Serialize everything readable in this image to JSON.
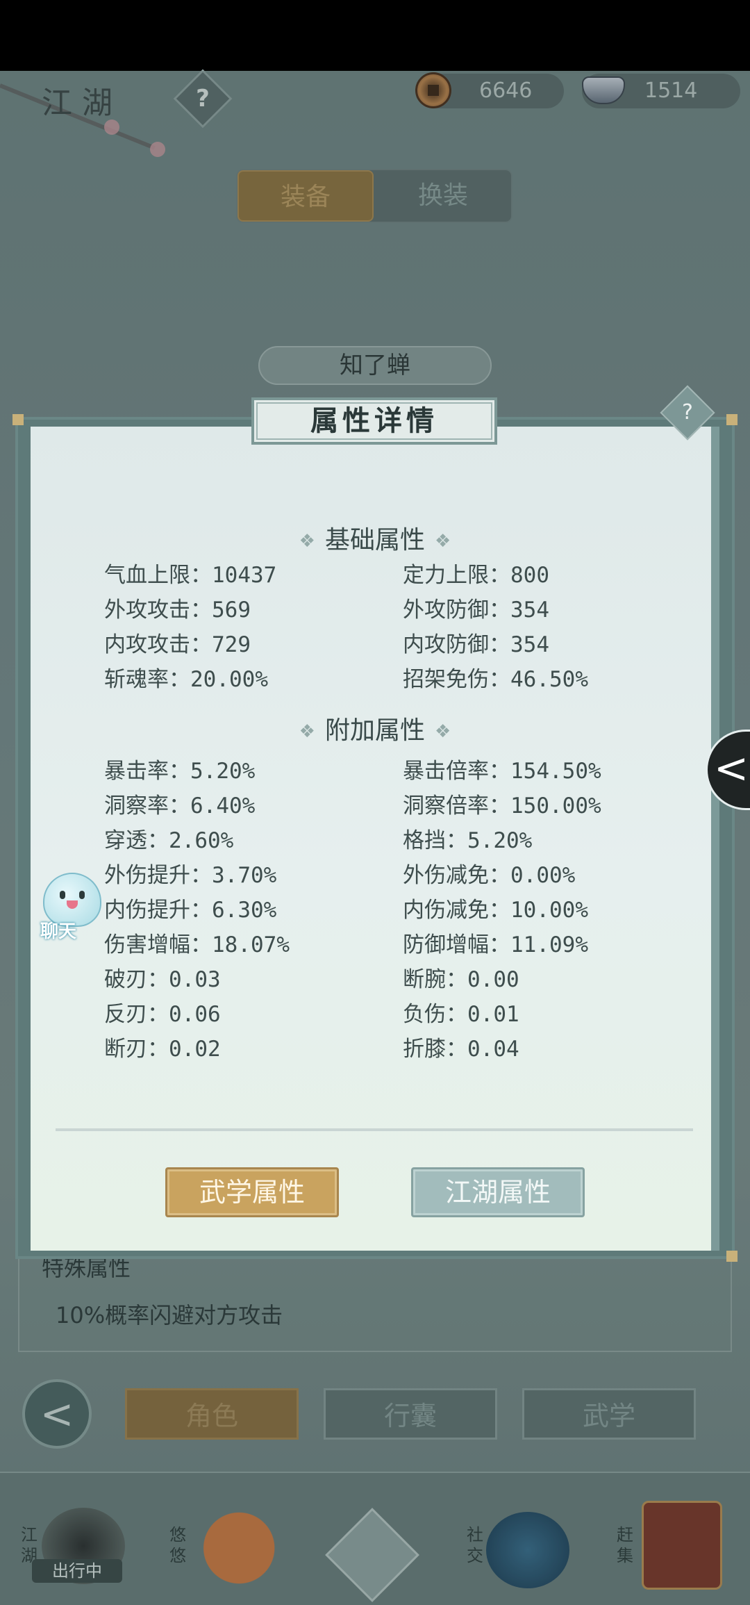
{
  "header": {
    "title": "江湖",
    "help_symbol": "?",
    "copper": "6646",
    "silver": "1514"
  },
  "tabs": {
    "equip": "装备",
    "swap": "换装"
  },
  "character_name": "知了蝉",
  "modal": {
    "title": "属性详情",
    "help_symbol": "?",
    "basic_title": "基础属性",
    "basic_stats": [
      "气血上限：10437",
      "定力上限：800",
      "外攻攻击：569",
      "外攻防御：354",
      "内攻攻击：729",
      "内攻防御：354",
      "斩魂率：20.00%",
      "招架免伤：46.50%"
    ],
    "extra_title": "附加属性",
    "extra_stats": [
      "暴击率：5.20%",
      "暴击倍率：154.50%",
      "洞察率：6.40%",
      "洞察倍率：150.00%",
      "穿透：2.60%",
      "格挡：5.20%",
      "外伤提升：3.70%",
      "外伤减免：0.00%",
      "内伤提升：6.30%",
      "内伤减免：10.00%",
      "伤害增幅：18.07%",
      "防御增幅：11.09%",
      "破刃：0.03",
      "断腕：0.00",
      "反刃：0.06",
      "负伤：0.01",
      "断刃：0.02",
      "折膝：0.04"
    ],
    "btn_martial": "武学属性",
    "btn_jianghu": "江湖属性"
  },
  "side_tab": {
    "chevron": "<"
  },
  "chat": {
    "label": "聊天"
  },
  "background": {
    "special_label": "特殊属性",
    "special_text": "10%概率闪避对方攻击"
  },
  "nav": {
    "back": "<",
    "role": "角色",
    "bag": "行囊",
    "martial": "武学"
  },
  "bottom": {
    "jianghu": "江湖",
    "traveling": "出行中",
    "youyou": "悠悠",
    "social": "社交",
    "market": "赶集"
  },
  "colors": {
    "accent_gold": "#c9a35f",
    "accent_teal": "#a2bcbc",
    "panel_bg": "#e3ecec"
  }
}
